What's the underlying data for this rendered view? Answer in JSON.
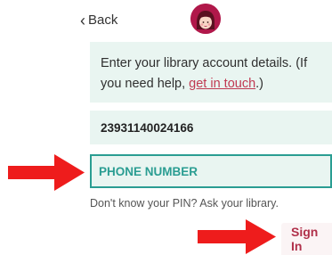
{
  "header": {
    "back_label": "Back",
    "back_icon": "chevron-left-icon",
    "logo_icon": "library-logo-icon"
  },
  "instructions": {
    "text_before": "Enter your library account details. (If you need help, ",
    "link_text": "get in touch",
    "text_after": ".)"
  },
  "form": {
    "barcode_value": "23931140024166",
    "pin_placeholder": "PHONE NUMBER",
    "pin_value": "",
    "pin_hint": "Don't know your PIN? Ask your library.",
    "submit_label": "Sign In"
  },
  "annotations": {
    "arrow_color": "#ee1c1c"
  },
  "colors": {
    "accent_teal": "#2a9d92",
    "field_background": "#e9f5f1",
    "link": "#c03a52",
    "sign_in_text": "#b0304a"
  }
}
